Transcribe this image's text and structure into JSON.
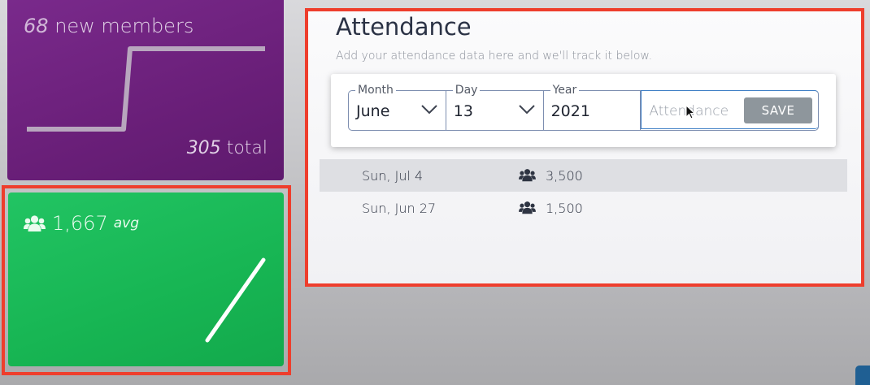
{
  "members_card": {
    "new_count": "68",
    "new_label": "new members",
    "total_count": "305",
    "total_label": "total",
    "color": "#6a1f79"
  },
  "avg_card": {
    "value": "1,667",
    "unit": "avg",
    "icon": "users-icon",
    "color": "#17b553"
  },
  "attendance": {
    "title": "Attendance",
    "subtitle": "Add your attendance data here and we'll track it below.",
    "form": {
      "month_label": "Month",
      "month_value": "June",
      "day_label": "Day",
      "day_value": "13",
      "year_label": "Year",
      "year_value": "2021",
      "attendance_placeholder": "Attendance",
      "save_label": "SAVE"
    },
    "records": [
      {
        "date": "Sun, Jul 4",
        "count": "3,500"
      },
      {
        "date": "Sun, Jun 27",
        "count": "1,500"
      }
    ]
  },
  "colors": {
    "highlight_outline": "#ee3e2d",
    "save_button": "#8e969c",
    "title_text": "#2b3245"
  }
}
